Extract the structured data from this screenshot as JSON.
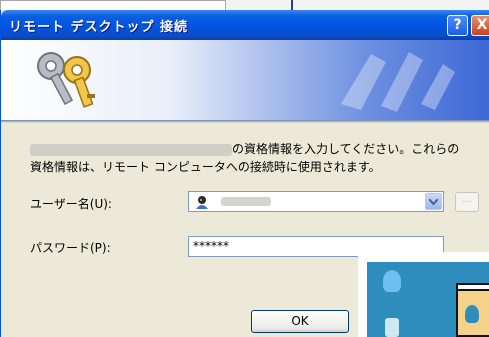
{
  "dialog": {
    "title": "リモート デスクトップ 接続",
    "help_button": "?",
    "close_button": "X"
  },
  "message": {
    "line1_suffix": "の資格情報を入力してください。これらの",
    "line2": "資格情報は、リモート コンピュータへの接続時に使用されます。"
  },
  "form": {
    "username_label": "ユーザー名(U):",
    "browse_button": "...",
    "password_label": "パスワード(P):",
    "password_value": "******"
  },
  "buttons": {
    "ok": "OK"
  }
}
